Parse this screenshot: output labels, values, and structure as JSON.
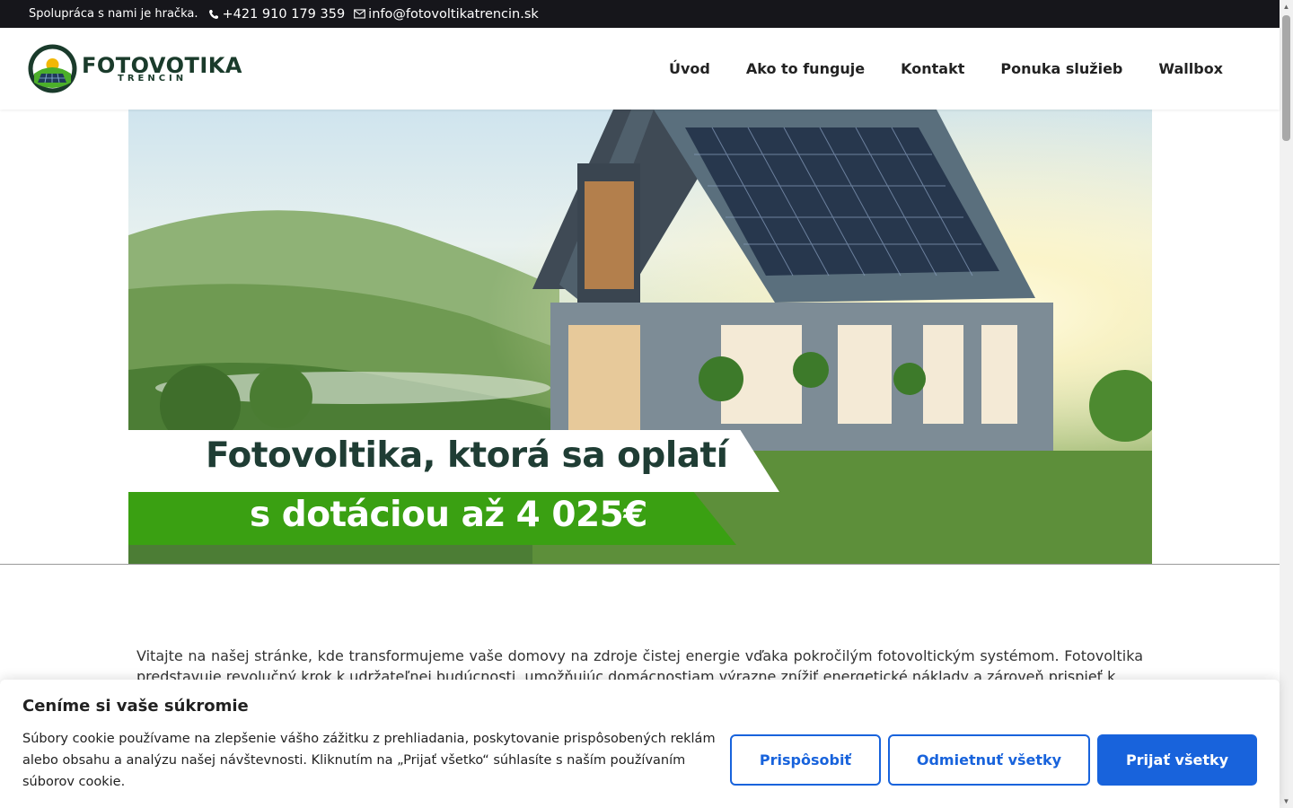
{
  "topbar": {
    "tagline": "Spolupráca s nami je hračka.",
    "phone": "+421 910 179 359",
    "email": "info@fotovoltikatrencin.sk"
  },
  "logo": {
    "main": "FOTOVOTIKA",
    "sub": "TRENCIN"
  },
  "nav": {
    "items": [
      {
        "label": "Úvod"
      },
      {
        "label": "Ako to funguje"
      },
      {
        "label": "Kontakt"
      },
      {
        "label": "Ponuka služieb"
      },
      {
        "label": "Wallbox"
      }
    ]
  },
  "hero": {
    "headline": "Fotovoltika, ktorá sa oplatí",
    "subline": "s dotáciou až 4 025€"
  },
  "intro": {
    "text": "Vitajte na našej stránke, kde transformujeme vaše domovy na zdroje čistej energie vďaka pokročilým fotovoltickým systémom. Fotovoltika predstavuje revolučný krok k udržateľnej budúcnosti, umožňujúc domácnostiam výrazne znížiť energetické náklady a zároveň prispieť k"
  },
  "cookie": {
    "title": "Ceníme si vaše súkromie",
    "text": "Súbory cookie používame na zlepšenie vášho zážitku z prehliadania, poskytovanie prispôsobených reklám alebo obsahu a analýzu našej návštevnosti. Kliknutím na „Prijať všetko“ súhlasíte s naším používaním súborov cookie.",
    "customize": "Prispôsobiť",
    "reject": "Odmietnuť všetky",
    "accept": "Prijať všetky"
  },
  "colors": {
    "topbar_bg": "#16161b",
    "accent_blue": "#1863dc",
    "banner_green": "#3aa012",
    "logo_dark": "#1a3b2b"
  }
}
